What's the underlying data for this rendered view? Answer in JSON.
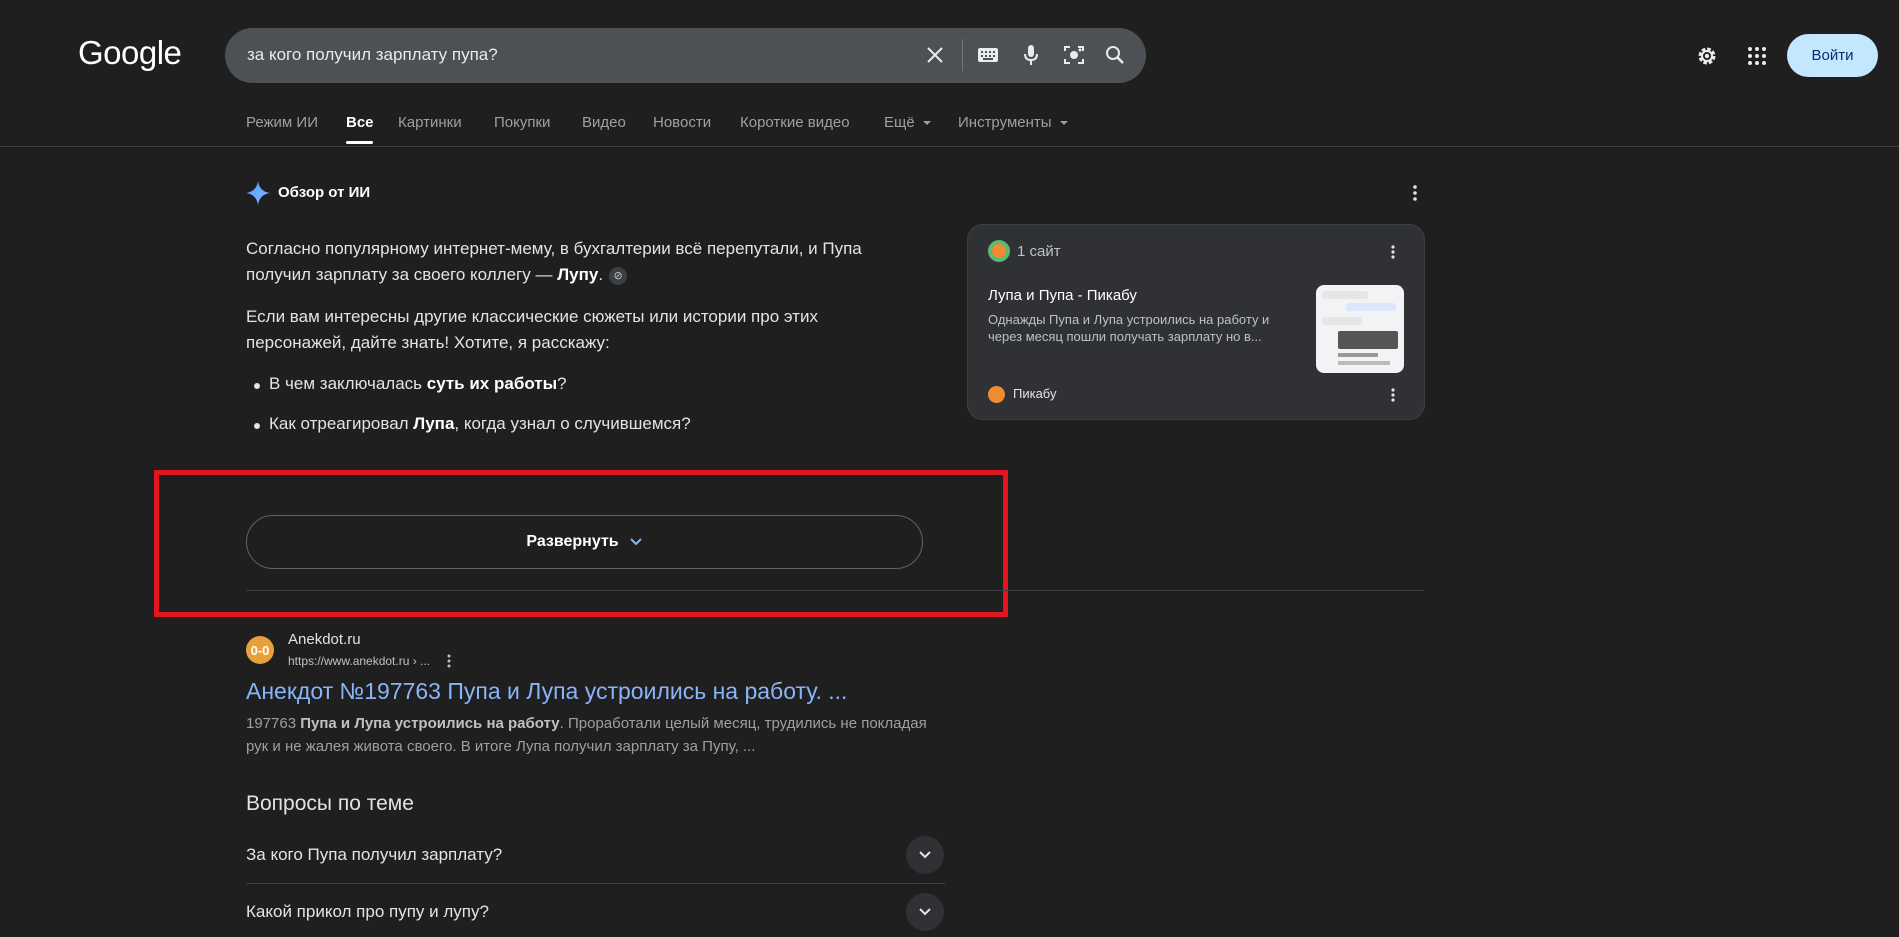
{
  "header": {
    "logo": "Google",
    "search_value": "за кого получил зарплату пупа?",
    "login_label": "Войти"
  },
  "tabs": [
    {
      "label": "Режим ИИ"
    },
    {
      "label": "Все"
    },
    {
      "label": "Картинки"
    },
    {
      "label": "Покупки"
    },
    {
      "label": "Видео"
    },
    {
      "label": "Новости"
    },
    {
      "label": "Короткие видео"
    },
    {
      "label": "Ещё"
    },
    {
      "label": "Инструменты"
    }
  ],
  "ai_overview": {
    "title": "Обзор от ИИ",
    "p1_a": "Согласно популярному интернет-мему, в бухгалтерии всё перепутали, и Пупа получил зарплату за своего коллегу — ",
    "p1_b": "Лупу",
    "p1_c": ".",
    "p2": "Если вам интересны другие классические сюжеты или истории про этих персонажей, дайте знать! Хотите, я расскажу:",
    "bullet1_a": "В чем заключалась ",
    "bullet1_b": "суть их работы",
    "bullet1_c": "?",
    "bullet2_a": "Как отреагировал ",
    "bullet2_b": "Лупа",
    "bullet2_c": ", когда узнал о случившемся?",
    "expand_label": "Развернуть"
  },
  "source_card": {
    "count_label": "1 сайт",
    "title": "Лупа и Пупа - Пикабу",
    "snippet": "Однажды Пупа и Лупа устроились на работу и через месяц пошли получать зарплату но в...",
    "source_name": "Пикабу"
  },
  "result": {
    "favicon_text": "0-0",
    "site": "Anekdot.ru",
    "url": "https://www.anekdot.ru › ...",
    "title": "Анекдот №197763 Пупа и Лупа устроились на работу. ...",
    "snippet_num": "197763 ",
    "snippet_bold": "Пупа и Лупа устроились на работу",
    "snippet_rest": ". Проработали целый месяц, трудились не покладая рук и не жалея живота своего. В итоге Лупа получил зарплату за Пупу, ..."
  },
  "paa": {
    "title": "Вопросы по теме",
    "questions": [
      {
        "label": "За кого Пупа получил зарплату?"
      },
      {
        "label": "Какой прикол про пупу и лупу?"
      }
    ]
  },
  "colors": {
    "background": "#1f1f1f",
    "link": "#8ab4f8",
    "highlight": "#e3161f",
    "login_bg": "#c2e7ff"
  }
}
